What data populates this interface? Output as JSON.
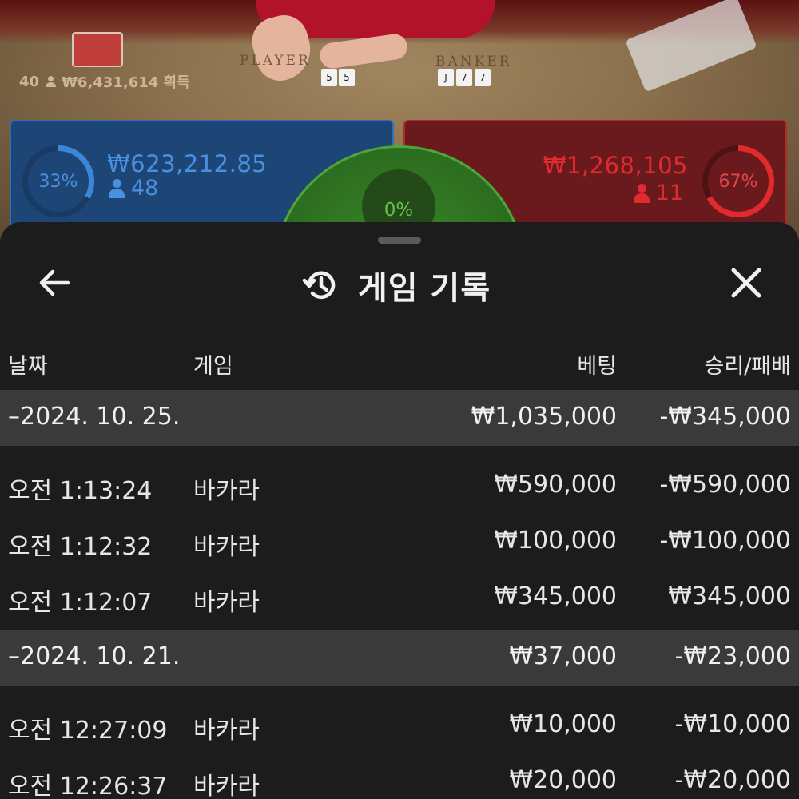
{
  "table": {
    "player_label": "PLAYER",
    "banker_label": "BANKER",
    "player_count": "40",
    "winnings": "₩6,431,614 획득",
    "player_cards": [
      "5",
      "5"
    ],
    "banker_cards": [
      "J",
      "7",
      "7"
    ]
  },
  "bets": {
    "player": {
      "percent": "33%",
      "amount": "₩623,212.85",
      "count": "48",
      "fill_fraction": 0.33,
      "color": "#3a86d8"
    },
    "banker": {
      "percent": "67%",
      "amount": "₩1,268,105",
      "count": "11",
      "fill_fraction": 0.67,
      "color": "#e02a2f"
    },
    "tie": {
      "percent": "0%",
      "color": "#66c24c"
    }
  },
  "sheet": {
    "back_icon": "arrow-left-icon",
    "history_icon": "history-icon",
    "close_icon": "close-icon",
    "title": "게임 기록"
  },
  "columns": {
    "date": "날짜",
    "game": "게임",
    "bet": "베팅",
    "result": "승리/패배"
  },
  "groups": [
    {
      "date": "–2024. 10. 25.",
      "bet_total": "₩1,035,000",
      "result_total": "-₩345,000",
      "rows": [
        {
          "time": "오전 1:13:24",
          "game": "바카라",
          "bet": "₩590,000",
          "result": "-₩590,000"
        },
        {
          "time": "오전 1:12:32",
          "game": "바카라",
          "bet": "₩100,000",
          "result": "-₩100,000"
        },
        {
          "time": "오전 1:12:07",
          "game": "바카라",
          "bet": "₩345,000",
          "result": "₩345,000"
        }
      ]
    },
    {
      "date": "–2024. 10. 21.",
      "bet_total": "₩37,000",
      "result_total": "-₩23,000",
      "rows": [
        {
          "time": "오전 12:27:09",
          "game": "바카라",
          "bet": "₩10,000",
          "result": "-₩10,000"
        },
        {
          "time": "오전 12:26:37",
          "game": "바카라",
          "bet": "₩20,000",
          "result": "-₩20,000"
        }
      ]
    }
  ]
}
